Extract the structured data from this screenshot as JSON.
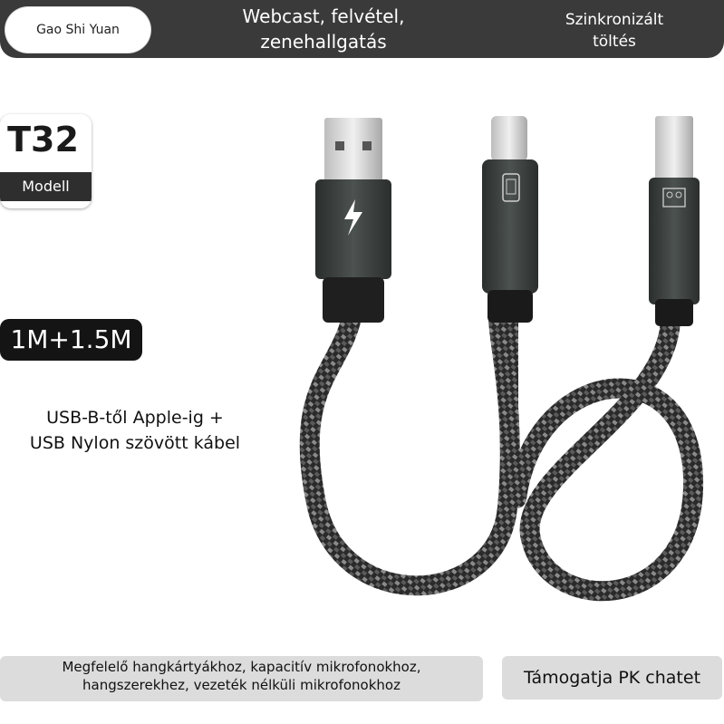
{
  "header": {
    "brand": "Gao Shi Yuan",
    "center_line1": "Webcast, felvétel,",
    "center_line2": "zenehallgatás",
    "right_line1": "Szinkronizált",
    "right_line2": "töltés"
  },
  "model": {
    "code": "T32",
    "label": "Modell"
  },
  "length": "1M+1.5M",
  "description": {
    "line1": "USB-B-től Apple-ig +",
    "line2": "USB Nylon szövött kábel"
  },
  "footer": {
    "left_line1": "Megfelelő hangkártyákhoz, kapacitív mikrofonokhoz,",
    "left_line2": "hangszerekhez, vezeték nélküli mikrofonokhoz",
    "right": "Támogatja PK chatet"
  },
  "icons": {
    "usb_a": "lightning-icon",
    "lightning": "phone-otg-icon",
    "usb_b": "audio-interface-icon"
  },
  "colors": {
    "bar": "#3a3a3a",
    "cable": "#2b2b2b",
    "connector": "#3d4240"
  }
}
